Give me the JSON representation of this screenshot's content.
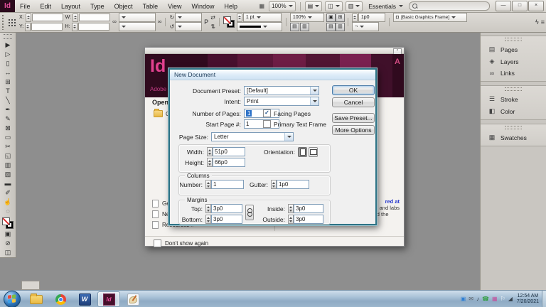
{
  "colors": {
    "app_maroon": "#2b0a1c",
    "brand_pink": "#e5509c",
    "dialog_border": "#2e7486",
    "selection_blue": "#2f73c8",
    "link_blue": "#2233cc"
  },
  "menu_bar": {
    "logo": "Id",
    "items": [
      {
        "label": "File",
        "name": "menu-file"
      },
      {
        "label": "Edit",
        "name": "menu-edit"
      },
      {
        "label": "Layout",
        "name": "menu-layout"
      },
      {
        "label": "Type",
        "name": "menu-type"
      },
      {
        "label": "Object",
        "name": "menu-object"
      },
      {
        "label": "Table",
        "name": "menu-table"
      },
      {
        "label": "View",
        "name": "menu-view"
      },
      {
        "label": "Window",
        "name": "menu-window"
      },
      {
        "label": "Help",
        "name": "menu-help"
      }
    ],
    "zoom": "100%",
    "workspace": "Essentials"
  },
  "icons": {
    "bridge": "▦",
    "screen_mode": "◫",
    "view_options": "▤",
    "arrange_docs": "▥",
    "minimize": "—",
    "restore": "□",
    "close": "×",
    "chain": "∞",
    "rotate_cw": "↻",
    "rotate_ccw": "↺",
    "flip_h": "⇄",
    "flip_v": "⇅",
    "p_badge": "P",
    "corner_style": "¬",
    "lightning": "ϟ",
    "panel_menu": "≡",
    "fx1": "▣",
    "fx2": "▤",
    "fx3": "▥",
    "fx4": "⊞",
    "frame_badge": "◘",
    "close_small": "×"
  },
  "control_bar": {
    "x_label": "X:",
    "y_label": "Y:",
    "w_label": "W:",
    "h_label": "H:",
    "stroke_weight": "1 pt",
    "opacity": "100%",
    "corner_radius": "1p0",
    "frame_style": "[Basic Graphics Frame]"
  },
  "toolbox": {
    "tools": [
      {
        "name": "selection-tool-icon",
        "glyph": "▶"
      },
      {
        "name": "direct-selection-tool-icon",
        "glyph": "▷"
      },
      {
        "name": "page-tool-icon",
        "glyph": "▯"
      },
      {
        "name": "gap-tool-icon",
        "glyph": "↔"
      },
      {
        "name": "content-collector-tool-icon",
        "glyph": "⊞"
      },
      {
        "name": "type-tool-icon",
        "glyph": "T"
      },
      {
        "name": "line-tool-icon",
        "glyph": "╲"
      },
      {
        "name": "pen-tool-icon",
        "glyph": "✒"
      },
      {
        "name": "pencil-tool-icon",
        "glyph": "✎"
      },
      {
        "name": "frame-tool-icon",
        "glyph": "⊠"
      },
      {
        "name": "rectangle-tool-icon",
        "glyph": "▭"
      },
      {
        "name": "scissors-tool-icon",
        "glyph": "✂"
      },
      {
        "name": "free-transform-tool-icon",
        "glyph": "◱"
      },
      {
        "name": "gradient-swatch-tool-icon",
        "glyph": "▥"
      },
      {
        "name": "gradient-feather-tool-icon",
        "glyph": "▨"
      },
      {
        "name": "note-tool-icon",
        "glyph": "▬"
      },
      {
        "name": "eyedropper-tool-icon",
        "glyph": "✐"
      },
      {
        "name": "hand-tool-icon",
        "glyph": "☝"
      },
      {
        "name": "zoom-tool-icon",
        "glyph": "◌"
      }
    ],
    "bottom": [
      {
        "name": "formatting-affects-icon",
        "glyph": "▣"
      },
      {
        "name": "apply-none-icon",
        "glyph": "⊘"
      },
      {
        "name": "view-mode-icon",
        "glyph": "◫"
      }
    ]
  },
  "welcome": {
    "id_logo": "Id",
    "adobe_text": "Adobe",
    "adobe_mark": "A",
    "open_heading": "Open a",
    "open_item": "Op",
    "links": [
      {
        "label": "Ge",
        "name": "welcome-item-getting-started"
      },
      {
        "label": "Ne",
        "name": "welcome-item-new-features"
      },
      {
        "label": "Resources »",
        "name": "welcome-item-resources"
      }
    ],
    "fragment_link": "red at",
    "fragment_2": "and labs",
    "paragraph": "led by expert speakers from around the world.",
    "dont_show_label": "Don't show again"
  },
  "dialog": {
    "title": "New Document",
    "preset_label": "Document Preset:",
    "preset_value": "[Default]",
    "intent_label": "Intent:",
    "intent_value": "Print",
    "pages_label": "Number of Pages:",
    "pages_value": "1",
    "start_label": "Start Page #:",
    "start_value": "1",
    "facing_label": "Facing Pages",
    "facing_checkmark": "✓",
    "primary_label": "Primary Text Frame",
    "size_label": "Page Size:",
    "size_value": "Letter",
    "width_label": "Width:",
    "width_value": "51p0",
    "height_label": "Height:",
    "height_value": "66p0",
    "orientation_label": "Orientation:",
    "columns_heading": "Columns",
    "col_number_label": "Number:",
    "col_number_value": "1",
    "gutter_label": "Gutter:",
    "gutter_value": "1p0",
    "margins_heading": "Margins",
    "top_label": "Top:",
    "top_value": "3p0",
    "bottom_label": "Bottom:",
    "bottom_value": "3p0",
    "inside_label": "Inside:",
    "inside_value": "3p0",
    "outside_label": "Outside:",
    "outside_value": "3p0",
    "buttons": {
      "ok": "OK",
      "cancel": "Cancel",
      "save_preset": "Save Preset...",
      "more_options": "More Options"
    }
  },
  "panels": {
    "group1": [
      {
        "label": "Pages",
        "glyph": "▤",
        "name": "panel-pages",
        "icon_name": "pages-icon"
      },
      {
        "label": "Layers",
        "glyph": "◈",
        "name": "panel-layers",
        "icon_name": "layers-icon"
      },
      {
        "label": "Links",
        "glyph": "∞",
        "name": "panel-links",
        "icon_name": "links-icon"
      }
    ],
    "group2": [
      {
        "label": "Stroke",
        "glyph": "☰",
        "name": "panel-stroke",
        "icon_name": "stroke-icon"
      },
      {
        "label": "Color",
        "glyph": "◧",
        "name": "panel-color",
        "icon_name": "color-icon"
      }
    ],
    "group3": [
      {
        "label": "Swatches",
        "glyph": "▦",
        "name": "panel-swatches",
        "icon_name": "swatches-icon"
      }
    ]
  },
  "taskbar": {
    "word_label": "W",
    "indesign_label": "Id",
    "tray": [
      {
        "glyph": "▣",
        "name": "tray-app-icon",
        "style": "color:#2f7fd4"
      },
      {
        "glyph": "✉",
        "name": "tray-message-icon",
        "style": "color:#5a5f66"
      },
      {
        "glyph": "♪",
        "name": "tray-volume-icon",
        "style": "color:#37424d"
      },
      {
        "glyph": "☎",
        "name": "tray-phone-icon",
        "style": "color:#2f9e3f"
      },
      {
        "glyph": "▦",
        "name": "tray-color-app-icon",
        "style": "color:#c44f9b"
      },
      {
        "glyph": "⚐",
        "name": "tray-action-center-icon",
        "style": "color:#f2f5f8"
      },
      {
        "glyph": "◢",
        "name": "tray-network-icon",
        "style": "color:#37424d"
      }
    ],
    "clock_time": "12:54 AM",
    "clock_date": "7/20/2021"
  }
}
